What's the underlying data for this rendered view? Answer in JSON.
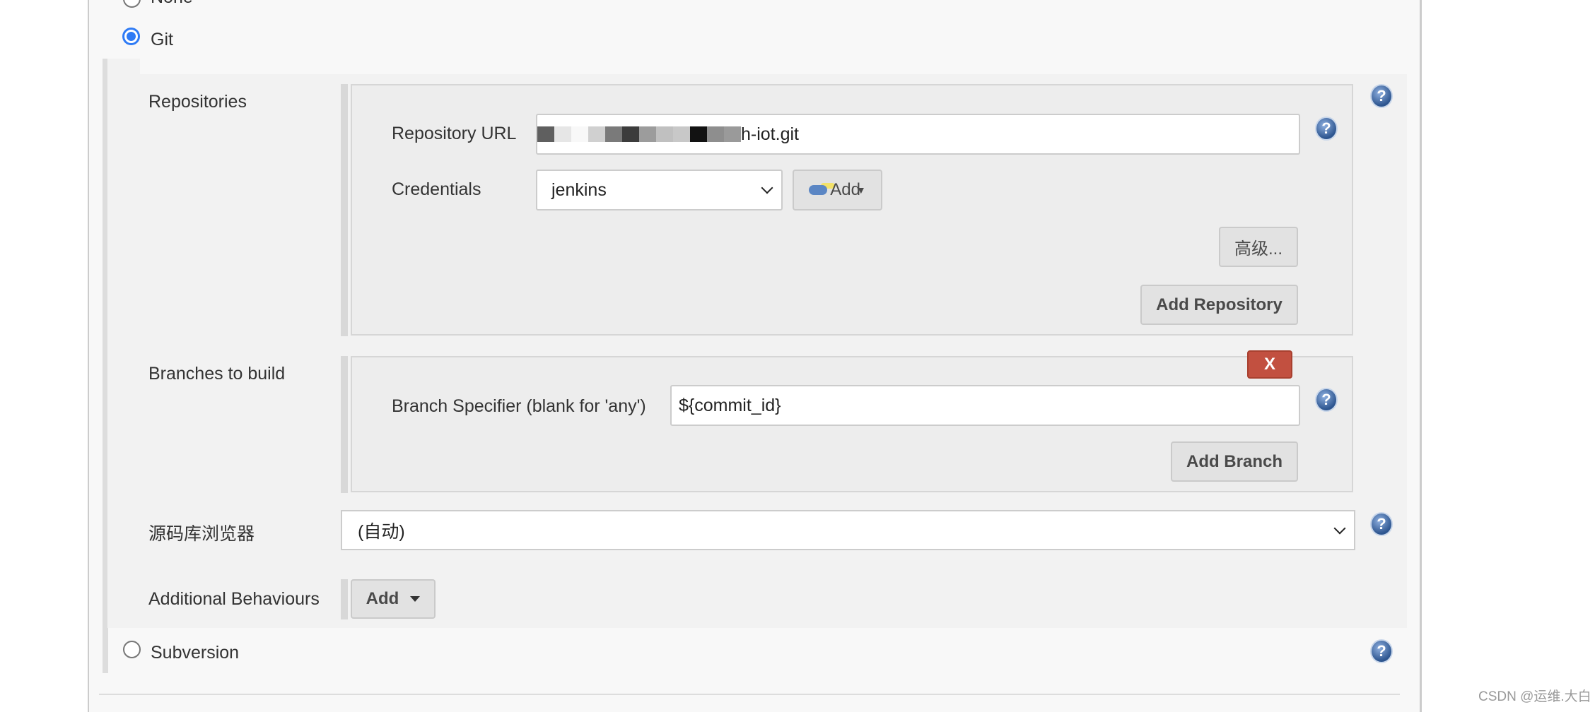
{
  "scm_options": [
    {
      "label": "None",
      "selected": false
    },
    {
      "label": "Git",
      "selected": true
    },
    {
      "label": "Subversion",
      "selected": false
    }
  ],
  "repositories": {
    "label": "Repositories",
    "url_label": "Repository URL",
    "url_visible_text": "h-iot.git",
    "credentials_label": "Credentials",
    "credentials_value": "jenkins",
    "add_label": "Add",
    "advanced_label": "高级...",
    "add_repository_label": "Add Repository"
  },
  "branches": {
    "label": "Branches to build",
    "delete_label": "X",
    "specifier_label": "Branch Specifier (blank for 'any')",
    "specifier_value": "${commit_id}",
    "add_branch_label": "Add Branch"
  },
  "browser": {
    "label": "源码库浏览器",
    "value": "(自动)"
  },
  "behaviours": {
    "label": "Additional Behaviours",
    "add_label": "Add"
  },
  "help_glyph": "?",
  "watermark": "CSDN @运维.大白",
  "colors": {
    "accent": "#2f7bf5",
    "danger": "#c25040",
    "help": "#2d558f"
  }
}
